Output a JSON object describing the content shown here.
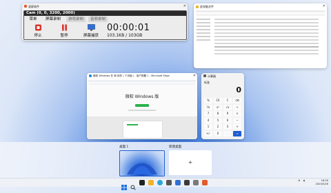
{
  "recorder": {
    "window_title": "录屏软件",
    "title_bar": "Cam (0, 0, 3200, 2000)",
    "tabs": [
      "菜单",
      "屏幕录制",
      "游戏录制",
      "音频录制"
    ],
    "buttons": {
      "stop": "停止",
      "pause": "暂停",
      "screenshot": "屏幕捕获"
    },
    "timer": "00:00:01",
    "rate": "103.1KB / 103GB"
  },
  "explorer": {
    "window_title": "此电脑文件"
  },
  "edge": {
    "window_title": "微软 Windows 在 和 软件 ( 个页面 ) - 用户配置 1 - Microsoft Edge",
    "page_heading": "微软 Windows 版"
  },
  "calculator": {
    "window_title": "计算器",
    "mode": "标准",
    "display": "0",
    "keys": [
      [
        "%",
        "CE",
        "C",
        "⌫"
      ],
      [
        "⅟x",
        "x²",
        "√x",
        "÷"
      ],
      [
        "7",
        "8",
        "9",
        "×"
      ],
      [
        "4",
        "5",
        "6",
        "−"
      ],
      [
        "1",
        "2",
        "3",
        "+"
      ],
      [
        "+/-",
        "0",
        ".",
        "="
      ]
    ]
  },
  "desktops": [
    {
      "label": "桌面 1"
    },
    {
      "label": "新建桌面",
      "add_symbol": "+"
    }
  ],
  "taskbar": {
    "time": "16:30",
    "date": "2023/5/26"
  },
  "colors": {
    "accent": "#1f5fd0",
    "stop_red": "#d9342b",
    "timer_text": "#111111"
  }
}
